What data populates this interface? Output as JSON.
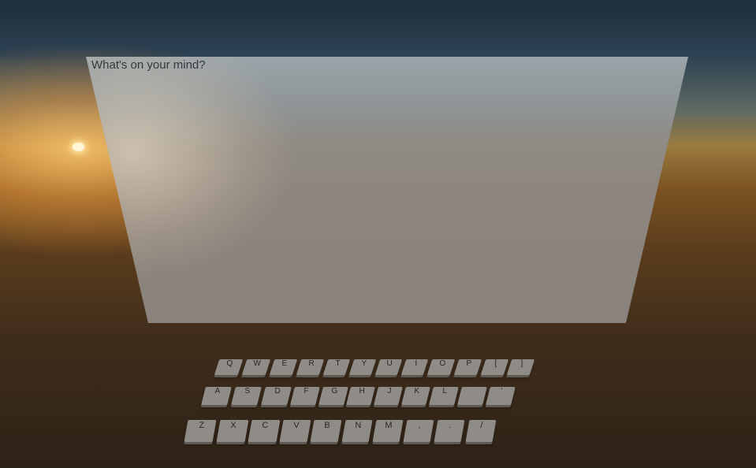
{
  "text_panel": {
    "placeholder": "What's on your mind?"
  },
  "keyboard": {
    "row1": [
      "Q",
      "W",
      "E",
      "R",
      "T",
      "Y",
      "U",
      "I",
      "O",
      "P",
      "[",
      "]"
    ],
    "row2": [
      "A",
      "S",
      "D",
      "F",
      "G",
      "H",
      "J",
      "K",
      "L",
      "",
      "'"
    ],
    "row3": [
      "Z",
      "X",
      "C",
      "V",
      "B",
      "N",
      "M",
      ",",
      ".",
      "/"
    ]
  },
  "colors": {
    "sky_top": "#1d2f3d",
    "horizon_glow": "#d9a050",
    "ground": "#2d2217",
    "panel": "#8c857e",
    "key": "#8f8b86"
  }
}
